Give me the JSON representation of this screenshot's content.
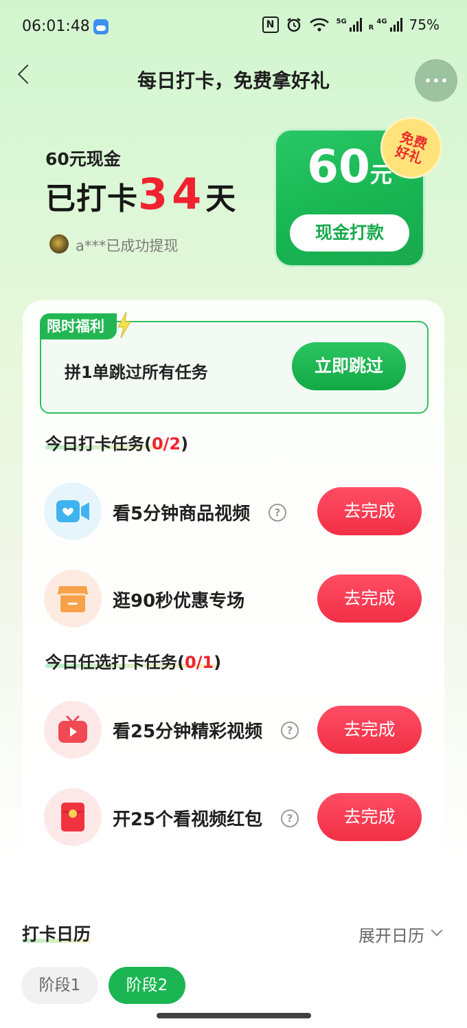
{
  "status_bar": {
    "time": "06:01:48",
    "nfc": "N",
    "net_5g": "5G",
    "net_4g": "4G",
    "roaming": "R",
    "battery": "75%"
  },
  "header": {
    "title": "每日打卡，免费拿好礼"
  },
  "hero": {
    "cash_label": "60元现金",
    "checkin_prefix": "已打卡",
    "checkin_days": "34",
    "checkin_suffix": "天",
    "withdraw_note": "a***已成功提现",
    "reward_amount": "60",
    "reward_unit": "元",
    "reward_button": "现金打款",
    "free_badge_line1": "免费",
    "free_badge_line2": "好礼"
  },
  "promo": {
    "tag": "限时福利",
    "text": "拼1单跳过所有任务",
    "button": "立即跳过"
  },
  "daily_tasks": {
    "title": "今日打卡任务",
    "progress": "0/2",
    "items": [
      {
        "label": "看5分钟商品视频",
        "button": "去完成",
        "icon": "video-camera-icon"
      },
      {
        "label": "逛90秒优惠专场",
        "button": "去完成",
        "icon": "shop-icon"
      }
    ]
  },
  "optional_tasks": {
    "title": "今日任选打卡任务",
    "progress": "0/1",
    "items": [
      {
        "label": "看25分钟精彩视频",
        "button": "去完成",
        "icon": "tv-play-icon"
      },
      {
        "label": "开25个看视频红包",
        "button": "去完成",
        "icon": "red-envelope-icon"
      }
    ]
  },
  "calendar": {
    "title": "打卡日历",
    "expand_label": "展开日历",
    "stages": [
      {
        "label": "阶段1",
        "active": false
      },
      {
        "label": "阶段2",
        "active": true
      }
    ]
  },
  "colors": {
    "primary_green": "#18b452",
    "accent_red": "#f0222f",
    "button_red": "#f13046"
  }
}
